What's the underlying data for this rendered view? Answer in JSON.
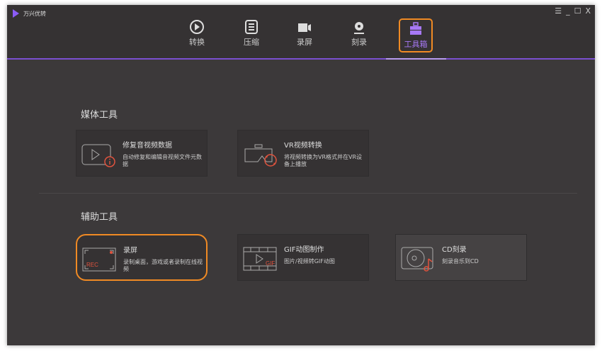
{
  "app": {
    "title": "万兴优转"
  },
  "window_controls": [
    "☰",
    "_",
    "☐",
    "X"
  ],
  "tabs": [
    {
      "label": "转换"
    },
    {
      "label": "压缩"
    },
    {
      "label": "录屏"
    },
    {
      "label": "刻录"
    },
    {
      "label": "工具箱",
      "active": true
    }
  ],
  "sections": [
    {
      "title": "媒体工具",
      "cards": [
        {
          "title": "修复音视频数据",
          "desc": "自动修复和编辑音视频文件元数据",
          "icon": "video-repair-icon"
        },
        {
          "title": "VR视频转换",
          "desc": "将视频转换为VR格式并在VR设备上播放",
          "icon": "vr-headset-icon"
        }
      ]
    },
    {
      "title": "辅助工具",
      "cards": [
        {
          "title": "录屏",
          "desc": "录制桌面，游戏或者录制在线视频",
          "icon": "screen-record-icon",
          "icon_text": "REC"
        },
        {
          "title": "GIF动图制作",
          "desc": "图片/视频转GIF动图",
          "icon": "gif-maker-icon",
          "icon_text": "GIF"
        },
        {
          "title": "CD刻录",
          "desc": "刻录音乐到CD",
          "icon": "cd-burn-icon"
        }
      ]
    }
  ],
  "colors": {
    "accent": "#8b5cf6",
    "highlight": "#f08a24",
    "icon_red": "#e0533e"
  }
}
